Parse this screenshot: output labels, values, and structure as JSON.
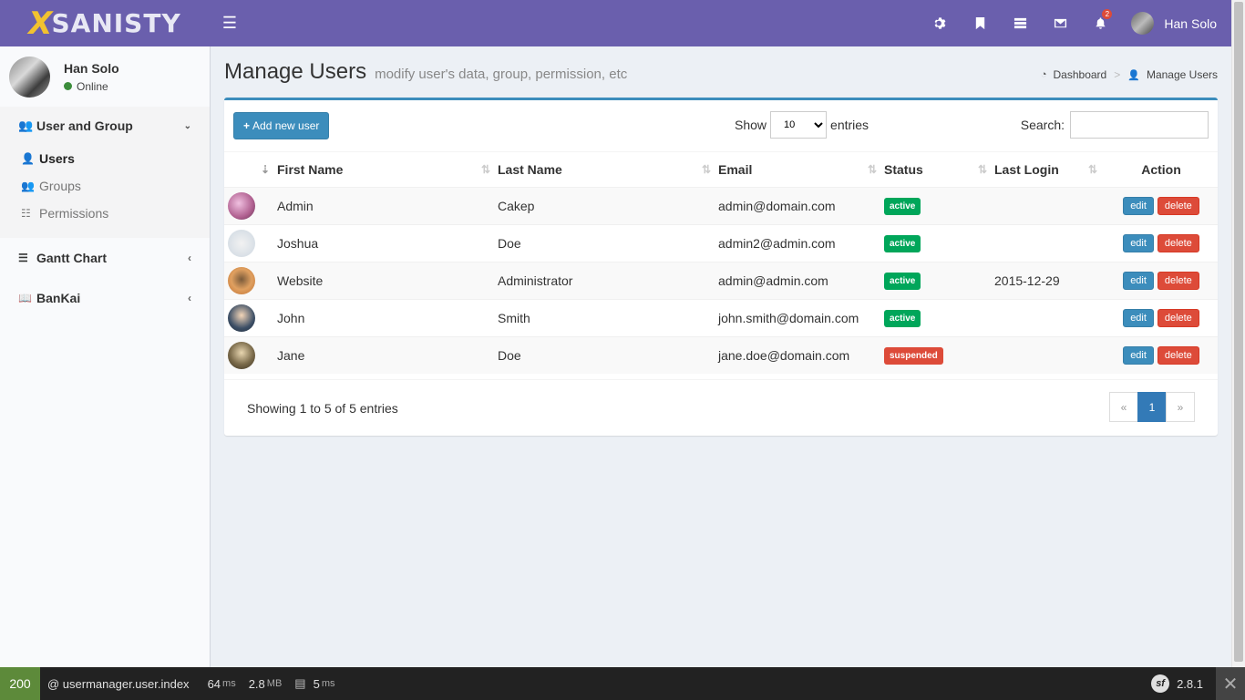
{
  "app": {
    "logo_x": "X",
    "logo_text": "SANISTY"
  },
  "header": {
    "user_name": "Han Solo",
    "notification_count": "2"
  },
  "sidebar": {
    "user_name": "Han Solo",
    "status": "Online",
    "sections": [
      {
        "label": "User and Group",
        "items": [
          {
            "label": "Users"
          },
          {
            "label": "Groups"
          },
          {
            "label": "Permissions"
          }
        ]
      },
      {
        "label": "Gantt Chart"
      },
      {
        "label": "BanKai"
      }
    ]
  },
  "page": {
    "title": "Manage Users",
    "subtitle": "modify user's data, group, permission, etc",
    "breadcrumb": [
      "Dashboard",
      "Manage Users"
    ]
  },
  "toolbar": {
    "add_label": "Add new user",
    "show_label": "Show",
    "entries_value": "10",
    "entries_label": "entries",
    "search_label": "Search:"
  },
  "table": {
    "headers": [
      "",
      "First Name",
      "Last Name",
      "Email",
      "Status",
      "Last Login",
      "Action"
    ],
    "rows": [
      {
        "first": "Admin",
        "last": "Cakep",
        "email": "admin@domain.com",
        "status": "active",
        "last_login": ""
      },
      {
        "first": "Joshua",
        "last": "Doe",
        "email": "admin2@admin.com",
        "status": "active",
        "last_login": ""
      },
      {
        "first": "Website",
        "last": "Administrator",
        "email": "admin@admin.com",
        "status": "active",
        "last_login": "2015-12-29"
      },
      {
        "first": "John",
        "last": "Smith",
        "email": "john.smith@domain.com",
        "status": "active",
        "last_login": ""
      },
      {
        "first": "Jane",
        "last": "Doe",
        "email": "jane.doe@domain.com",
        "status": "suspended",
        "last_login": ""
      }
    ],
    "edit_label": "edit",
    "delete_label": "delete"
  },
  "footer": {
    "info": "Showing 1 to 5 of 5 entries",
    "prev": "«",
    "page": "1",
    "next": "»"
  },
  "debug_bar": {
    "status_code": "200",
    "route": "@ usermanager.user.index",
    "time_value": "64",
    "time_unit": "ms",
    "memory_value": "2.8",
    "memory_unit": "MB",
    "db_value": "5",
    "db_unit": "ms",
    "version": "2.8.1"
  },
  "colors": {
    "header": "#6a5fad",
    "primary": "#3c8dbc",
    "active": "#00a65a",
    "suspended": "#dd4b39"
  }
}
